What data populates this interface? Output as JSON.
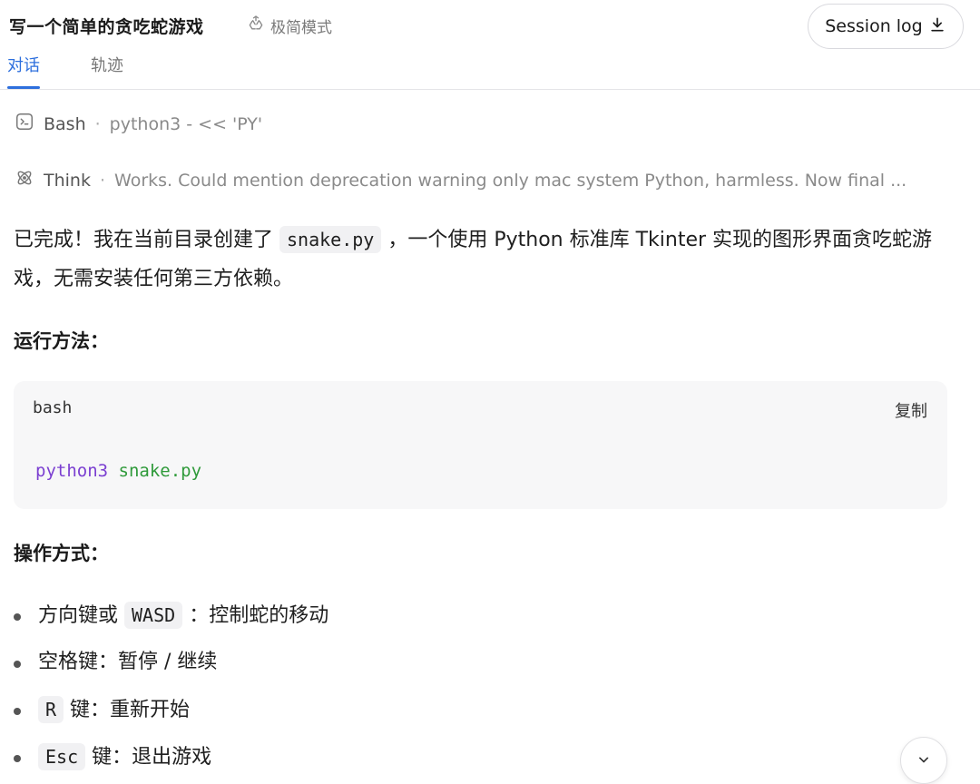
{
  "header": {
    "title": "写一个简单的贪吃蛇游戏",
    "mode_label": "极简模式",
    "session_log_label": "Session log"
  },
  "tabs": [
    {
      "label": "对话",
      "active": true
    },
    {
      "label": "轨迹",
      "active": false
    }
  ],
  "steps": [
    {
      "icon": "terminal-icon",
      "name": "Bash",
      "detail": "python3 - << 'PY'"
    },
    {
      "icon": "atom-icon",
      "name": "Think",
      "detail": "Works. Could mention deprecation warning only mac system Python, harmless. Now final ..."
    }
  ],
  "message": {
    "intro_before": "已完成！我在当前目录创建了",
    "intro_code": "snake.py",
    "intro_after": "，一个使用 Python 标准库 Tkinter 实现的图形界面贪吃蛇游戏，无需安装任何第三方依赖。",
    "run_heading": "运行方法：",
    "code": {
      "lang": "bash",
      "copy_label": "复制",
      "command": "python3",
      "arg": "snake.py"
    },
    "controls_heading": "操作方式：",
    "controls": [
      {
        "before": "方向键或",
        "code": "WASD",
        "after": "：控制蛇的移动"
      },
      {
        "before": "空格键：暂停 / 继续",
        "code": "",
        "after": ""
      },
      {
        "before": "",
        "code": "R",
        "after": "键：重新开始"
      },
      {
        "before": "",
        "code": "Esc",
        "after": "键：退出游戏"
      }
    ]
  },
  "colors": {
    "accent": "#2d6fdd",
    "code_command": "#7b3fd1",
    "code_arg": "#2f9a3a"
  }
}
